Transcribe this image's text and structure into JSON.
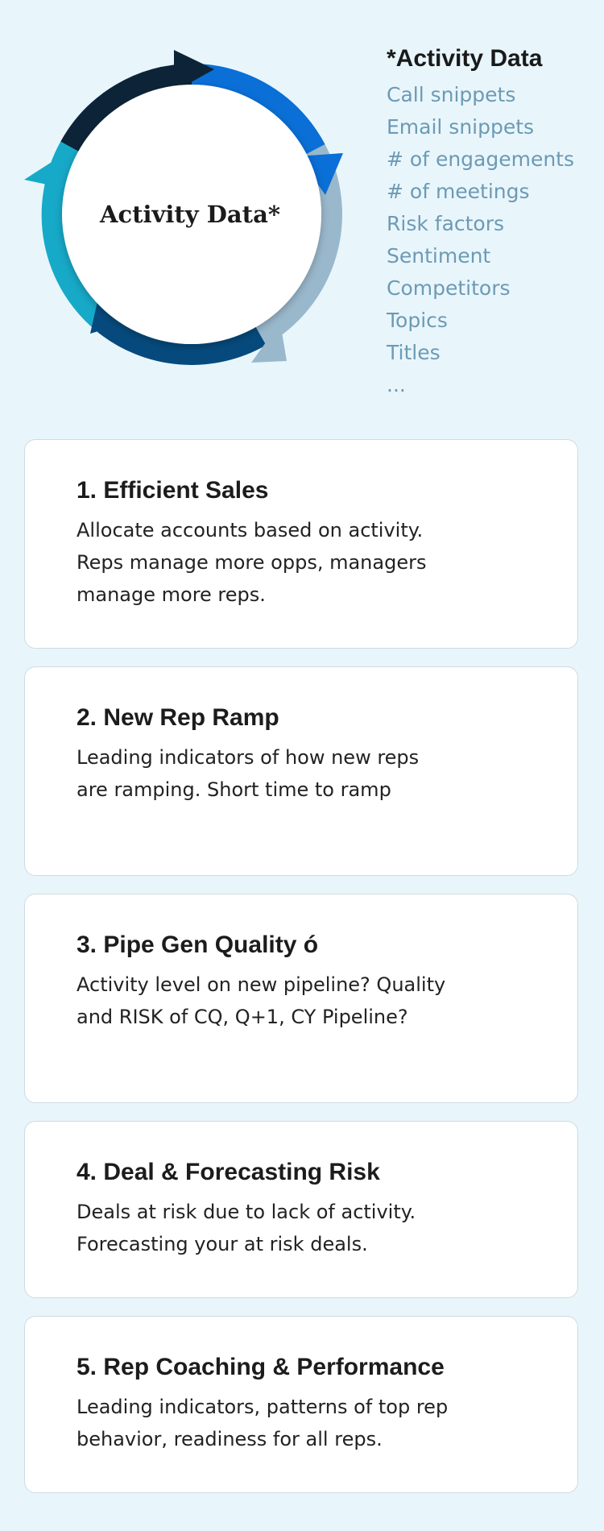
{
  "diagram": {
    "center_label": "Activity Data*",
    "colors": {
      "arc_top_left": "#0d2438",
      "arc_top_right": "#0a6fd6",
      "arc_right": "#9ab8cc",
      "arc_bottom": "#064a7d",
      "arc_left": "#17a9c8",
      "background": "#e8f6fc"
    }
  },
  "legend": {
    "title": "*Activity Data",
    "items": [
      "Call snippets",
      "Email snippets",
      "# of engagements",
      "# of meetings",
      "Risk factors",
      "Sentiment",
      "Competitors",
      "Topics",
      "Titles",
      "..."
    ]
  },
  "cards": [
    {
      "title": "1. Efficient Sales",
      "text": "Allocate accounts based on activity. Reps manage more opps, managers manage more reps."
    },
    {
      "title": "2. New Rep Ramp",
      "text": "Leading indicators of how new reps are ramping. Short time to ramp"
    },
    {
      "title": "3. Pipe Gen Quality ó",
      "text": "Activity level on new pipeline? Quality and RISK of CQ, Q+1, CY Pipeline?"
    },
    {
      "title": "4. Deal & Forecasting Risk",
      "text": "Deals at risk due to lack of activity. Forecasting your at risk deals."
    },
    {
      "title": "5. Rep Coaching & Performance",
      "text": "Leading indicators, patterns of top rep behavior, readiness for all reps."
    }
  ]
}
